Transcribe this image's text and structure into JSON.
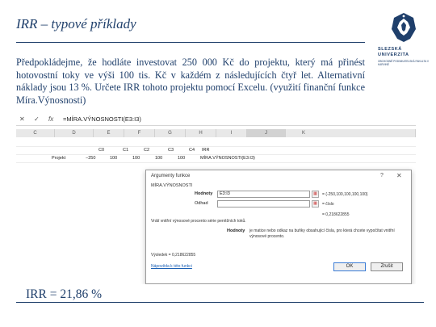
{
  "slide": {
    "title": "IRR – typové příklady",
    "paragraph": "Předpokládejme, že hodláte investovat 250 000 Kč do projektu, který má přinést hotovostní toky ve výši 100 tis. Kč v každém z následujících čtyř let. Alternativní náklady jsou 13 %. Určete IRR tohoto projektu pomocí Excelu. (využití finanční funkce Míra.Výnosnosti)",
    "result": "IRR = 21,86 %"
  },
  "logo": {
    "line1": "SLEZSKÁ",
    "line2": "UNIVERZITA",
    "faculty": "OBCHODNĚ PODNIKATELSKÁ FAKULTA V KARVINÉ"
  },
  "excel": {
    "icons": {
      "cancel": "✕",
      "enter": "✓",
      "fx": "fx"
    },
    "formula": "=MÍRA.VÝNOSNOSTI(E3:I3)",
    "columns": [
      "C",
      "D",
      "E",
      "F",
      "G",
      "H",
      "I",
      "J",
      "K"
    ],
    "row1": [
      "C0",
      "C1",
      "C2",
      "C3",
      "C4",
      "IRR"
    ],
    "row2_label": "Projekt",
    "row2": [
      "−250",
      "100",
      "100",
      "100",
      "100",
      "MÍRA.VÝNOSNOSTI(E3:I3)"
    ]
  },
  "dialog": {
    "title": "Argumenty funkce",
    "group": "MÍRA.VÝNOSNOSTI",
    "field1_label": "Hodnoty",
    "field1_value": "E3:I3",
    "field1_result": "= {-250,100,100,100,100}",
    "field2_label": "Odhad",
    "field2_result": "= číslo",
    "total": "= 0,218622855",
    "func_desc": "Vrátí vnitřní výnosové procento série peněžních toků.",
    "arg_label": "Hodnoty",
    "arg_desc": "je matice nebo odkaz na buňky obsahující čísla, pro která chcete vypočítat vnitřní výnosové procento.",
    "result_line": "Výsledek = 0,218622855",
    "help_link": "Nápověda k této funkci",
    "ok": "OK",
    "cancel": "Zrušit"
  },
  "colors": {
    "text": "#1f3f6b",
    "accent": "#1a5fb4"
  }
}
